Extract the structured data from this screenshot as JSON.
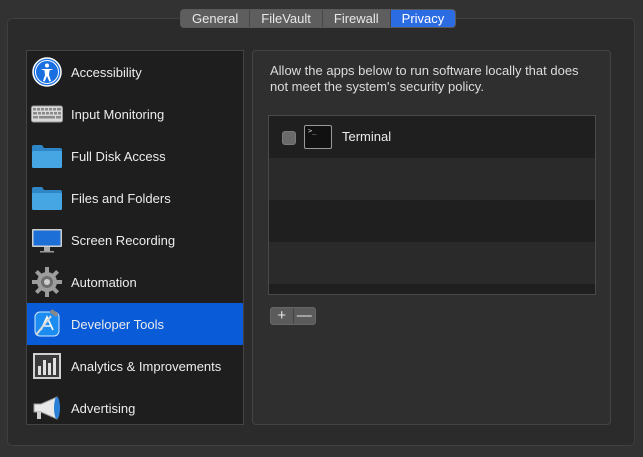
{
  "tabs": [
    {
      "label": "General",
      "active": false
    },
    {
      "label": "FileVault",
      "active": false
    },
    {
      "label": "Firewall",
      "active": false
    },
    {
      "label": "Privacy",
      "active": true
    }
  ],
  "sidebar": {
    "items": [
      {
        "label": "Accessibility",
        "icon": "accessibility-icon"
      },
      {
        "label": "Input Monitoring",
        "icon": "keyboard-icon"
      },
      {
        "label": "Full Disk Access",
        "icon": "folder-icon"
      },
      {
        "label": "Files and Folders",
        "icon": "folder-icon"
      },
      {
        "label": "Screen Recording",
        "icon": "display-icon"
      },
      {
        "label": "Automation",
        "icon": "gear-icon"
      },
      {
        "label": "Developer Tools",
        "icon": "developer-tools-icon",
        "selected": true
      },
      {
        "label": "Analytics & Improvements",
        "icon": "analytics-icon"
      },
      {
        "label": "Advertising",
        "icon": "megaphone-icon"
      }
    ]
  },
  "main": {
    "description": "Allow the apps below to run software locally that does not meet the system's security policy.",
    "apps": [
      {
        "name": "Terminal",
        "checked": false,
        "icon": "terminal-icon",
        "icon_text": ">_"
      }
    ],
    "add_label": "+",
    "remove_label": "—"
  },
  "colors": {
    "accent": "#2c6ce3",
    "selection": "#0a5bd8",
    "folder": "#3b9ad9"
  }
}
